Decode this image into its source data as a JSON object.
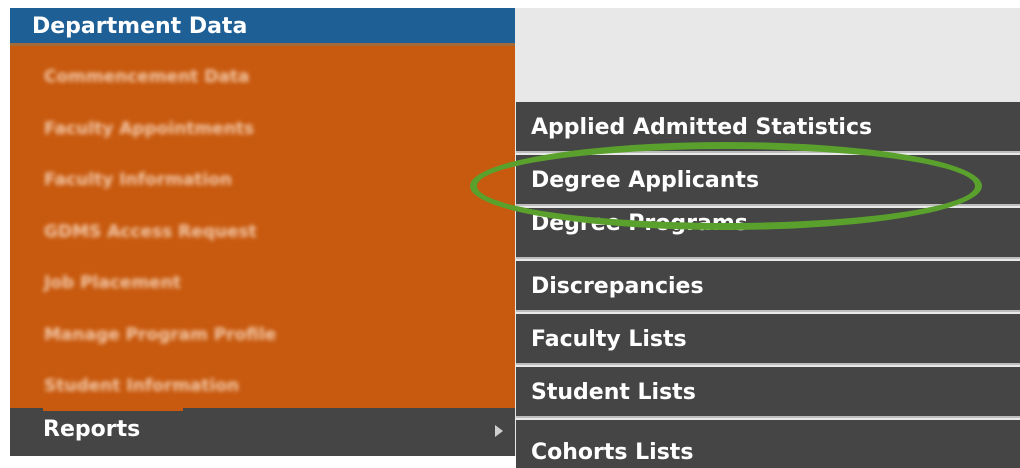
{
  "menu": {
    "header": "Department Data",
    "items": [
      "Commencement Data",
      "Faculty Appointments",
      "Faculty Information",
      "GDMS Access Request",
      "Job Placement",
      "Manage Program Profile",
      "Student Information"
    ],
    "reports_label": "Reports"
  },
  "submenu": {
    "items": [
      "Applied Admitted Statistics",
      "Degree Applicants",
      "Degree Programs",
      "Discrepancies",
      "Faculty Lists",
      "Student Lists",
      "Cohorts Lists"
    ]
  },
  "colors": {
    "menu_bg": "#c85a0f",
    "header_bg": "#1e5f95",
    "submenu_bg": "#454545",
    "highlight": "#5aa02c"
  },
  "icons": {
    "reports_arrow": "chevron-right-icon"
  }
}
